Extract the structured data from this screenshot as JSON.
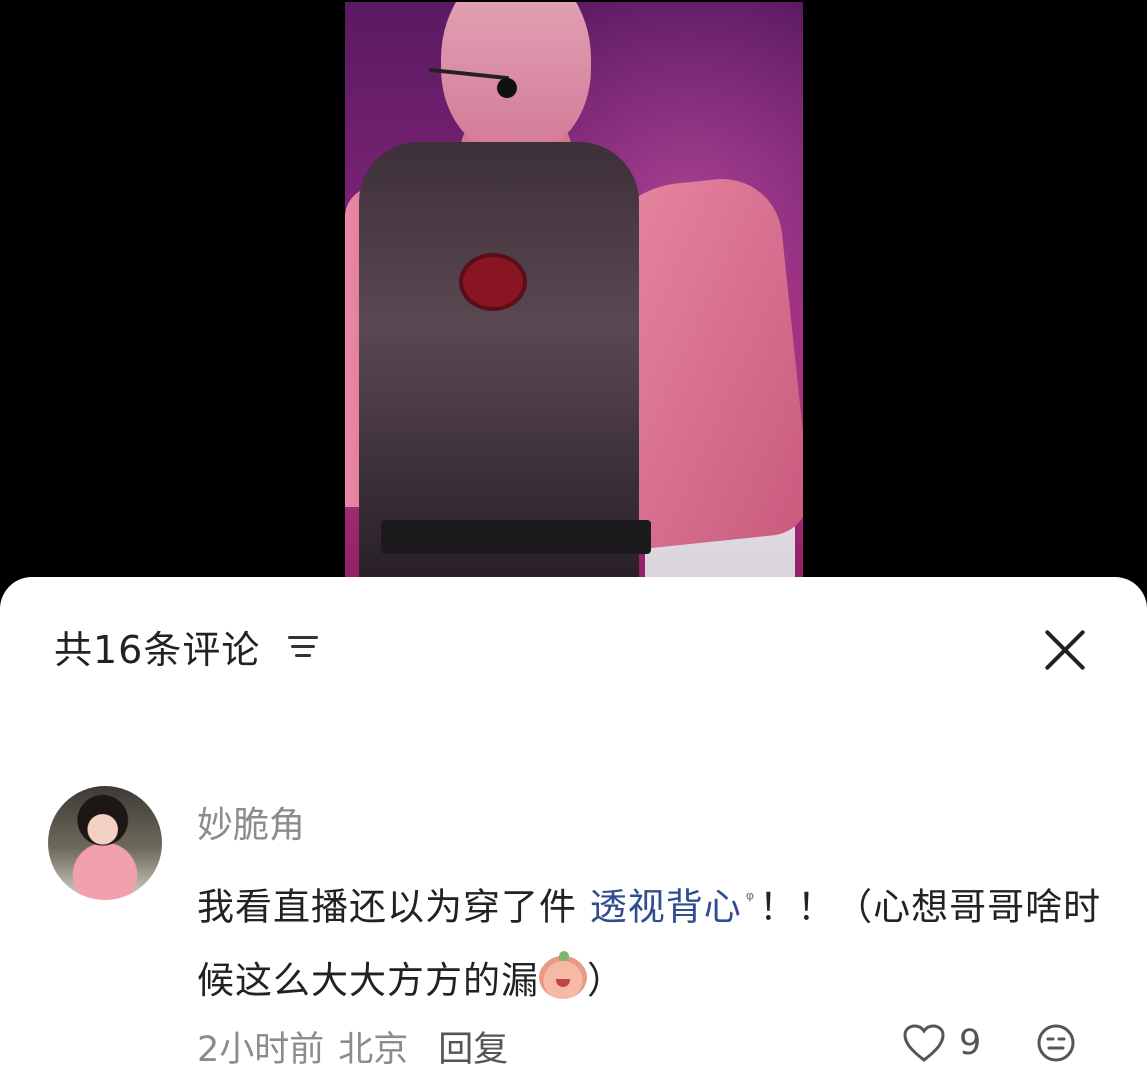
{
  "comments_sheet": {
    "title": "共16条评论"
  },
  "comment": {
    "username": "妙脆角",
    "text_before": "我看直播还以为穿了件 ",
    "link_text": "透视背心",
    "text_after": "！！（心想哥哥啥时候这么大大方方的漏",
    "text_end": "）",
    "time": "2小时前",
    "location": "北京",
    "reply_label": "回复",
    "likes": "9"
  }
}
